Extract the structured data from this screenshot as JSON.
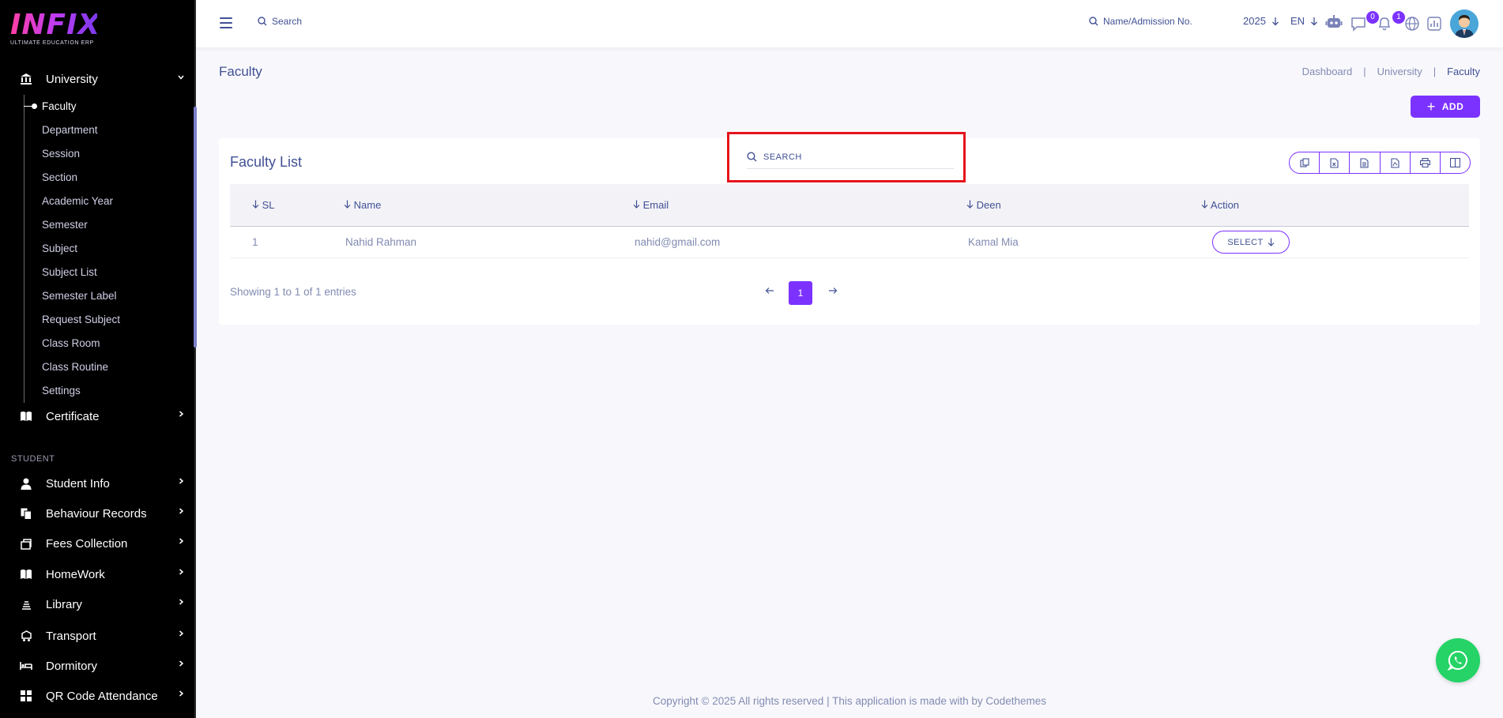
{
  "brand": {
    "logo_text": "INFIX",
    "tagline": "ULTIMATE EDUCATION ERP"
  },
  "sidebar": {
    "university": {
      "label": "University",
      "icon": "bank-icon"
    },
    "university_items": [
      {
        "label": "Faculty",
        "active": true
      },
      {
        "label": "Department"
      },
      {
        "label": "Session"
      },
      {
        "label": "Section"
      },
      {
        "label": "Academic Year"
      },
      {
        "label": "Semester"
      },
      {
        "label": "Subject"
      },
      {
        "label": "Subject List"
      },
      {
        "label": "Semester Label"
      },
      {
        "label": "Request Subject"
      },
      {
        "label": "Class Room"
      },
      {
        "label": "Class Routine"
      },
      {
        "label": "Settings"
      }
    ],
    "certificate": {
      "label": "Certificate",
      "icon": "book-icon"
    },
    "section_label": "STUDENT",
    "items": [
      {
        "label": "Student Info",
        "icon": "user-icon"
      },
      {
        "label": "Behaviour Records",
        "icon": "copy-icon"
      },
      {
        "label": "Fees Collection",
        "icon": "fees-icon"
      },
      {
        "label": "HomeWork",
        "icon": "book-icon"
      },
      {
        "label": "Library",
        "icon": "library-icon"
      },
      {
        "label": "Transport",
        "icon": "transport-icon"
      },
      {
        "label": "Dormitory",
        "icon": "bed-icon"
      },
      {
        "label": "QR Code Attendance",
        "icon": "grid-icon"
      }
    ]
  },
  "header": {
    "search_placeholder": "Search",
    "name_search_placeholder": "Name/Admission No.",
    "year": "2025",
    "language": "EN",
    "chat_count": "0",
    "notification_count": "1"
  },
  "page": {
    "title": "Faculty",
    "breadcrumb": [
      "Dashboard",
      "University",
      "Faculty"
    ],
    "add_label": "ADD"
  },
  "card": {
    "title": "Faculty List",
    "search_placeholder": "SEARCH",
    "columns": [
      "SL",
      "Name",
      "Email",
      "Deen",
      "Action"
    ],
    "rows": [
      {
        "sl": "1",
        "name": "Nahid Rahman",
        "email": "nahid@gmail.com",
        "deen": "Kamal Mia",
        "action": "SELECT"
      }
    ],
    "showing": "Showing 1 to 1 of 1 entries",
    "current_page": "1"
  },
  "footer": {
    "text": "Copyright © 2025 All rights reserved | This application is made with by Codethemes"
  },
  "colors": {
    "accent": "#7c32ff",
    "primary_text": "#415094",
    "muted_text": "#828bb2",
    "highlight": "#e6131b",
    "whatsapp": "#25d366"
  }
}
